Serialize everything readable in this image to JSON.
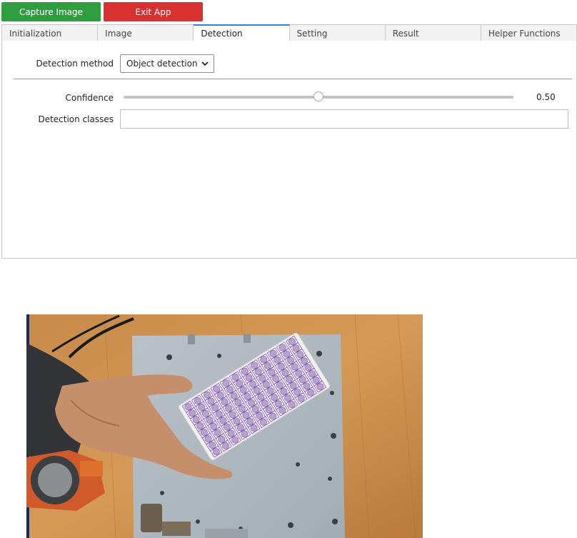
{
  "toolbar": {
    "capture_label": "Capture Image",
    "exit_label": "Exit App"
  },
  "tabs": [
    {
      "label": "Initialization",
      "active": false
    },
    {
      "label": "Image",
      "active": false
    },
    {
      "label": "Detection",
      "active": true
    },
    {
      "label": "Setting",
      "active": false
    },
    {
      "label": "Result",
      "active": false
    },
    {
      "label": "Helper Functions",
      "active": false
    }
  ],
  "detection": {
    "method_label": "Detection method",
    "method_value": "Object detection",
    "confidence_label": "Confidence",
    "confidence_value": "0.50",
    "confidence_fraction": 0.5,
    "classes_label": "Detection classes",
    "classes_value": ""
  },
  "colors": {
    "capture": "#2e9e3f",
    "exit": "#d93030",
    "active_tab": "#2f7fd6",
    "detection_box": "#7b3fe4"
  },
  "image": {
    "icon": "camera-frame-image"
  }
}
